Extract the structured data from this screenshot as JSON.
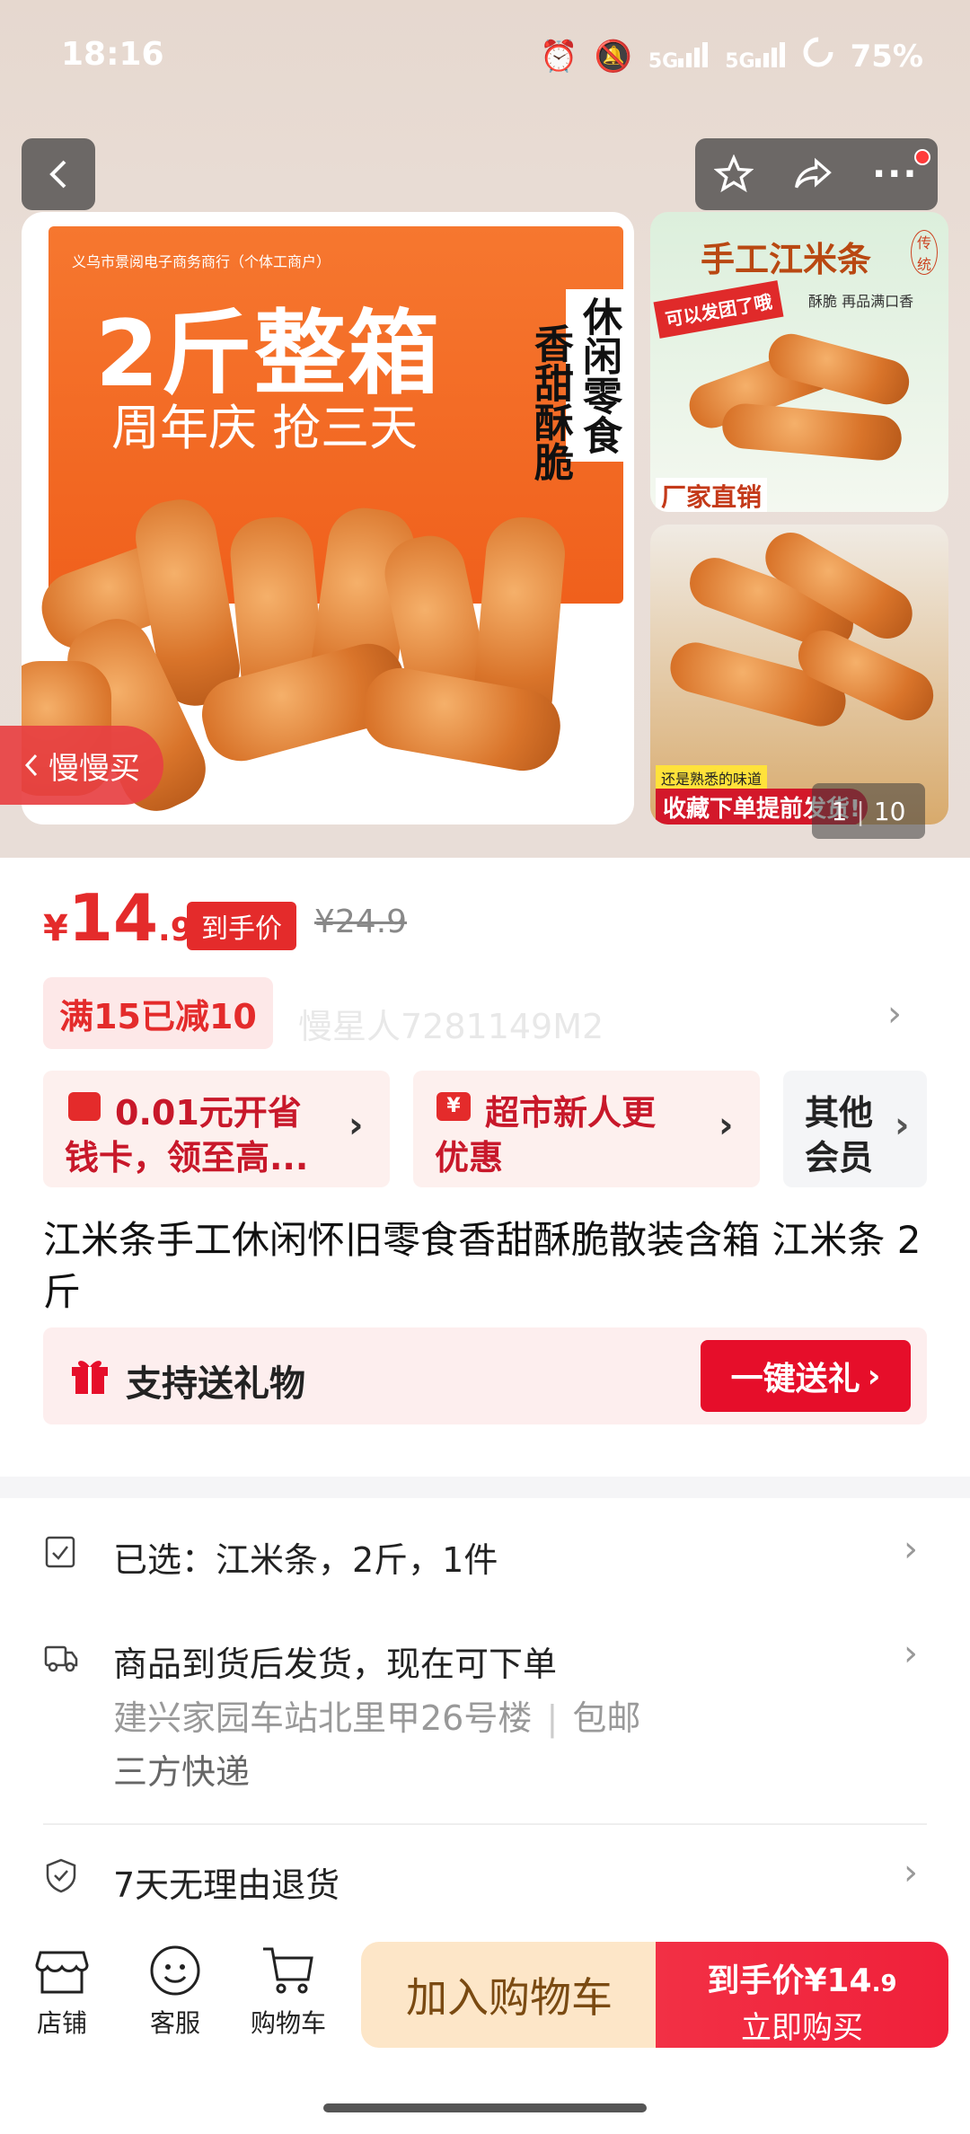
{
  "status_bar": {
    "time": "18:16",
    "battery": "75%",
    "network1": "5G",
    "network2": "5G"
  },
  "gallery": {
    "box_small": "义乌市景阅电子商务商行（个体工商户）",
    "box_title": "2斤整箱",
    "box_sub": "周年庆  抢三天",
    "box_vert1": "休闲零食",
    "box_vert2": "香甜酥脆",
    "box_footer": "义乌市景阅电子商务商行（个体工商户）",
    "thumb1_title": "手工江米条",
    "thumb1_badge": "传统",
    "thumb1_sticker": "可以发团了哦",
    "thumb1_sub": "酥脆 再品满口香",
    "thumb1_footer": "厂家直销",
    "thumb2_tag": "还是熟悉的味道",
    "thumb2_banner": "收藏下单提前发货!",
    "slow_buy": "慢慢买",
    "counter_current": "1",
    "counter_total": "10"
  },
  "price": {
    "currency": "¥",
    "integer": "14",
    "decimal": ".9",
    "tag": "到手价",
    "original": "¥24.9"
  },
  "promo": {
    "label": "满15已减10",
    "watermark": "慢星人7281149M2"
  },
  "cards": [
    {
      "line1": "0.01元开省",
      "line2": "钱卡，领至高..."
    },
    {
      "line1": "超市新人更",
      "line2": "优惠"
    },
    {
      "line1": "其他",
      "line2": "会员"
    }
  ],
  "product_title": "江米条手工休闲怀旧零食香甜酥脆散装含箱 江米条 2斤",
  "gift": {
    "label": "支持送礼物",
    "button": "一键送礼"
  },
  "selected": {
    "text": "已选：江米条，2斤，1件"
  },
  "shipping": {
    "line1": "商品到货后发货，现在可下单",
    "address": "建兴家园车站北里甲26号楼",
    "free": "包邮",
    "line3": "三方快递"
  },
  "returns": {
    "text": "7天无理由退货"
  },
  "bottom_bar": {
    "shop": "店铺",
    "service": "客服",
    "cart": "购物车",
    "add_cart": "加入购物车",
    "buy_price_label": "到手价",
    "buy_price": "¥14",
    "buy_price_decimal": ".9",
    "buy_now": "立即购买"
  },
  "colors": {
    "accent": "#e42b2b",
    "cart_bg": "#fde6c8",
    "buy_bg": "#f0203a"
  }
}
